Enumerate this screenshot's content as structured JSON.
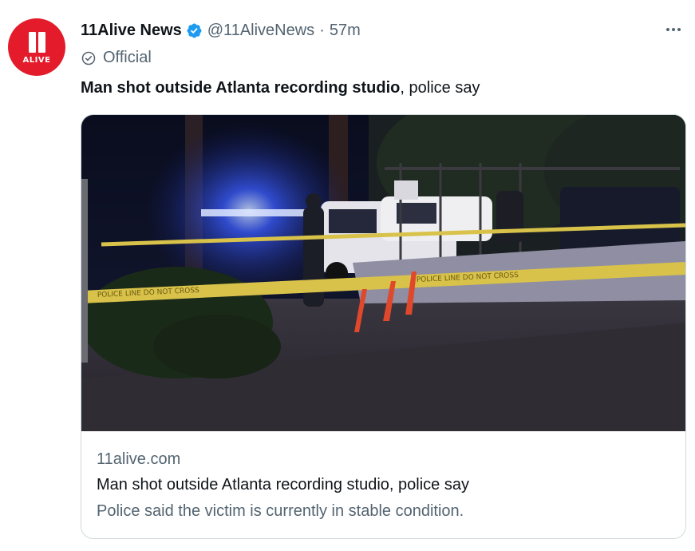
{
  "tweet": {
    "author": {
      "avatar_text": "ALIVE",
      "display_name": "11Alive News",
      "handle": "@11AliveNews",
      "separator": "·",
      "time": "57m",
      "badge": "Official",
      "verified_icon": "verified-badge-icon",
      "brand_color": "#e31b2b"
    },
    "text_bold": "Man shot outside Atlanta recording studio",
    "text_rest": ", police say",
    "card": {
      "domain": "11alive.com",
      "title": "Man shot outside Atlanta recording studio, police say",
      "description": "Police said the victim is currently in stable condition.",
      "tape_text": "POLICE LINE DO NOT CROSS"
    }
  },
  "colors": {
    "text_primary": "#0f1419",
    "text_secondary": "#536471",
    "verified_blue": "#1d9bf0",
    "border": "#cfd9de"
  }
}
